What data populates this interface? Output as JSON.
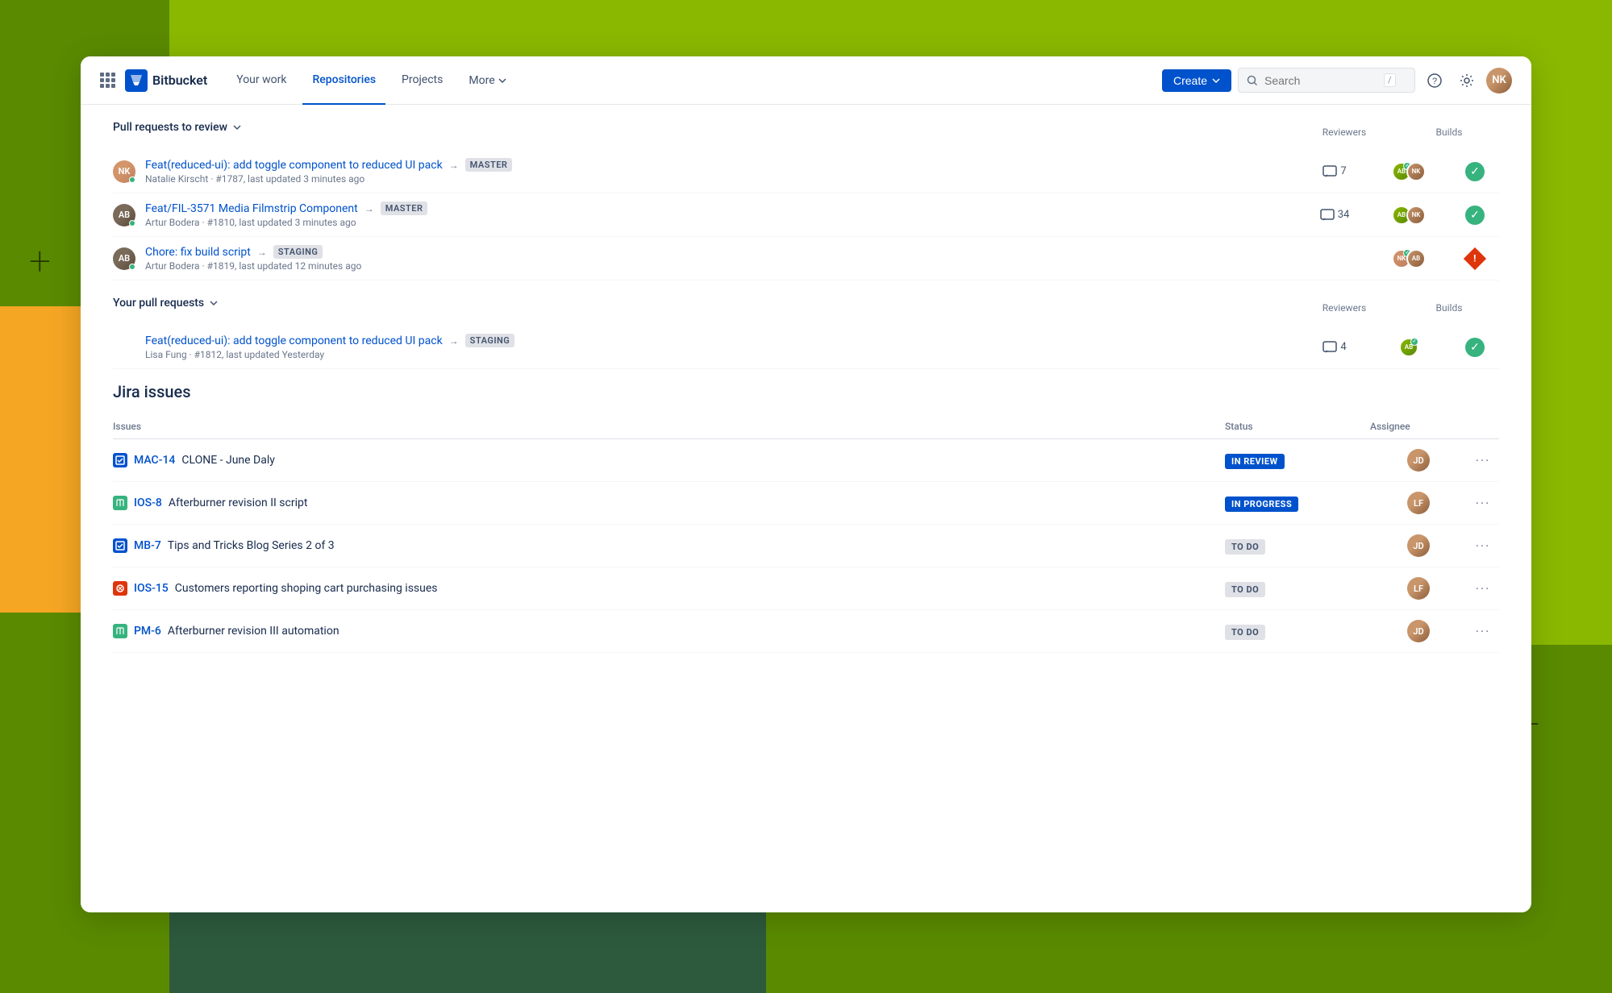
{
  "background": {
    "colors": {
      "green_dark": "#5a8a00",
      "green_light": "#8ab800",
      "dark_green": "#2d5a3d",
      "orange": "#f5a623"
    }
  },
  "navbar": {
    "logo_text": "Bitbucket",
    "links": [
      {
        "label": "Your work",
        "active": false
      },
      {
        "label": "Repositories",
        "active": true
      },
      {
        "label": "Projects",
        "active": false
      }
    ],
    "more_label": "More",
    "create_label": "Create",
    "search_placeholder": "Search",
    "search_kbd": "/"
  },
  "pull_requests_to_review": {
    "section_label": "Pull requests to review",
    "col_reviewers": "Reviewers",
    "col_builds": "Builds",
    "items": [
      {
        "title": "Feat(reduced-ui): add toggle component to reduced UI pack",
        "branch": "MASTER",
        "author": "Natalie Kirscht",
        "pr_num": "#1787",
        "updated": "last updated 3 minutes ago",
        "comments": 7,
        "build": "success"
      },
      {
        "title": "Feat/FIL-3571 Media Filmstrip Component",
        "branch": "MASTER",
        "author": "Artur Bodera",
        "pr_num": "#1810",
        "updated": "last updated 3 minutes ago",
        "comments": 34,
        "build": "success"
      },
      {
        "title": "Chore: fix build script",
        "branch": "STAGING",
        "author": "Artur Bodera",
        "pr_num": "#1819",
        "updated": "last updated 12 minutes ago",
        "comments": null,
        "build": "fail"
      }
    ]
  },
  "your_pull_requests": {
    "section_label": "Your pull requests",
    "col_reviewers": "Reviewers",
    "col_builds": "Builds",
    "items": [
      {
        "title": "Feat(reduced-ui): add toggle component to reduced UI pack",
        "branch": "STAGING",
        "author": "Lisa Fung",
        "pr_num": "#1812",
        "updated": "last updated Yesterday",
        "comments": 4,
        "build": "success"
      }
    ]
  },
  "jira": {
    "section_title": "Jira issues",
    "col_issues": "Issues",
    "col_status": "Status",
    "col_assignee": "Assignee",
    "items": [
      {
        "key": "MAC-14",
        "type": "task",
        "name": "CLONE - June Daly",
        "status": "IN REVIEW",
        "status_type": "in-review"
      },
      {
        "key": "IOS-8",
        "type": "story",
        "name": "Afterburner revision II script",
        "status": "IN PROGRESS",
        "status_type": "in-progress"
      },
      {
        "key": "MB-7",
        "type": "task",
        "name": "Tips and Tricks Blog Series 2 of 3",
        "status": "TO DO",
        "status_type": "to-do"
      },
      {
        "key": "IOS-15",
        "type": "bug",
        "name": "Customers reporting shoping cart purchasing issues",
        "status": "TO DO",
        "status_type": "to-do"
      },
      {
        "key": "PM-6",
        "type": "story",
        "name": "Afterburner revision III automation",
        "status": "TO DO",
        "status_type": "to-do"
      }
    ]
  }
}
